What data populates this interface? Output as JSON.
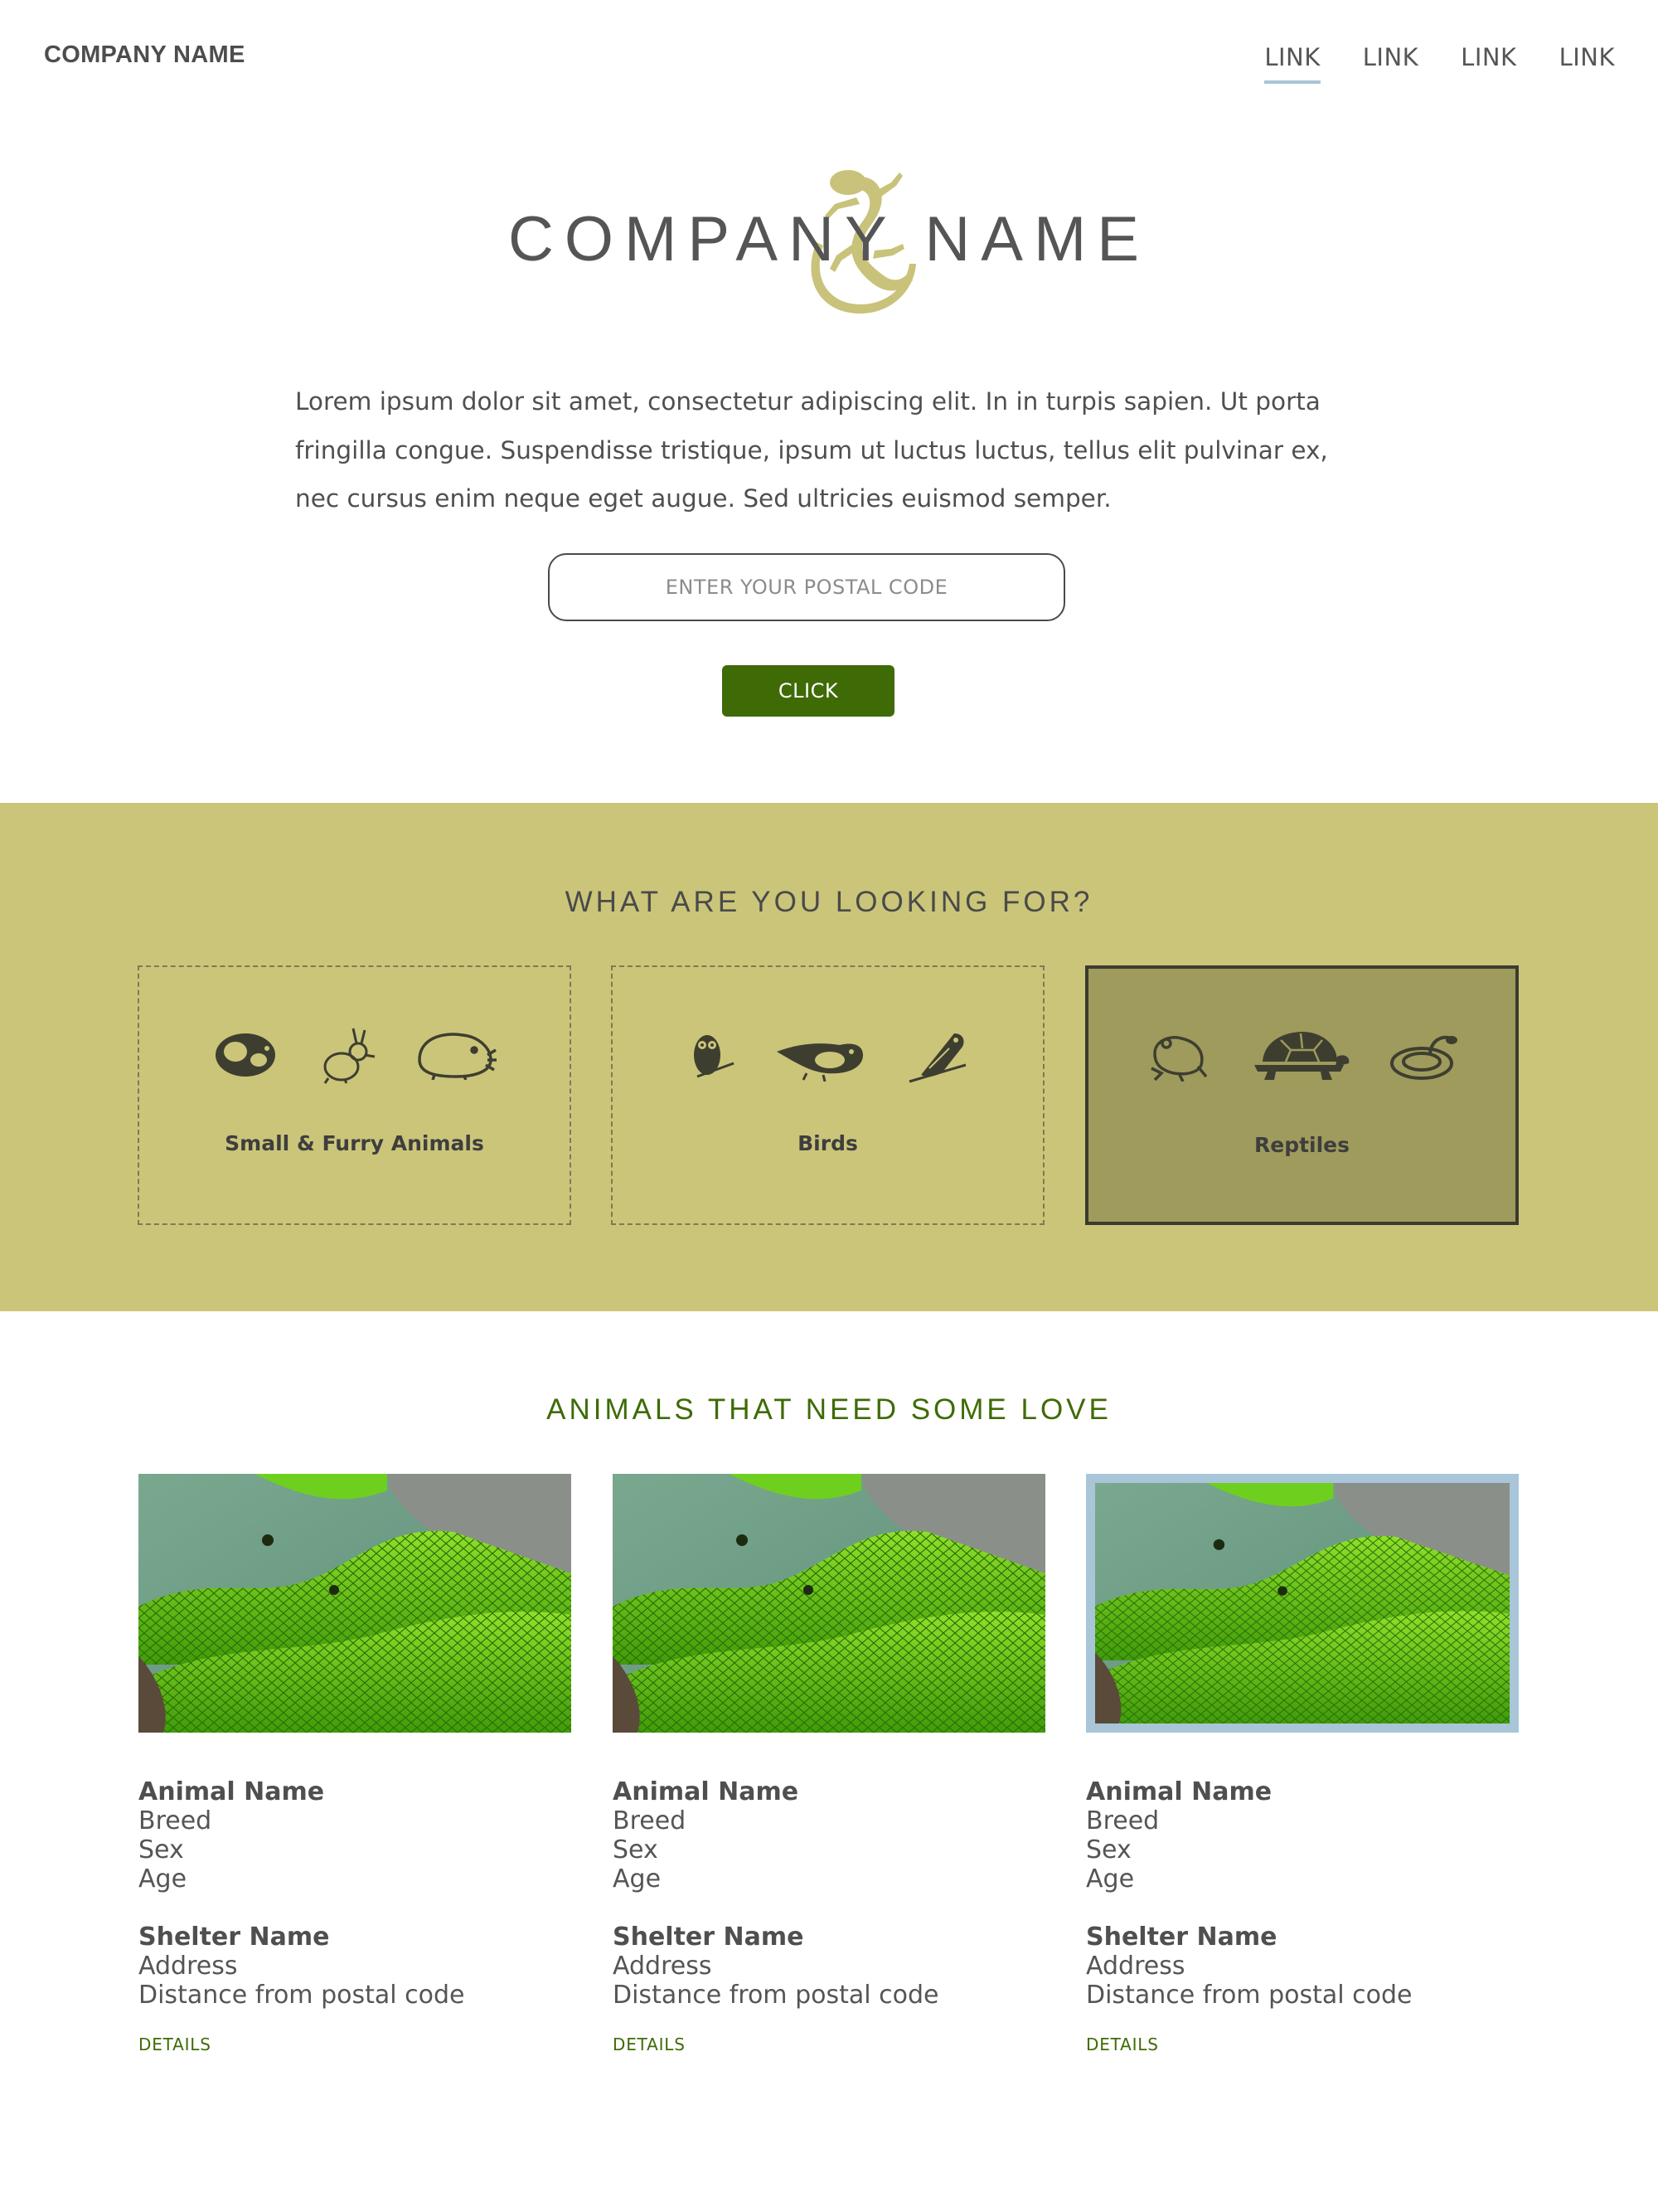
{
  "header": {
    "brand": "COMPANY NAME",
    "nav": [
      {
        "label": "LINK",
        "active": true
      },
      {
        "label": "LINK",
        "active": false
      },
      {
        "label": "LINK",
        "active": false
      },
      {
        "label": "LINK",
        "active": false
      }
    ]
  },
  "hero": {
    "logo_text": "COMPANY NAME",
    "intro": "Lorem ipsum dolor sit amet, consectetur adipiscing elit. In in turpis sapien. Ut porta fringilla congue. Suspendisse tristique, ipsum ut luctus luctus, tellus elit pulvinar ex, nec cursus enim neque eget augue. Sed ultricies euismod semper.",
    "postal_placeholder": "ENTER YOUR POSTAL CODE",
    "postal_value": "",
    "button_label": "CLICK"
  },
  "categories": {
    "title": "WHAT ARE YOU LOOKING FOR?",
    "items": [
      {
        "label": "Small & Furry Animals",
        "icons": [
          "guinea-pig-icon",
          "rabbit-icon",
          "hamster-icon"
        ],
        "selected": false
      },
      {
        "label": "Birds",
        "icons": [
          "owl-icon",
          "sparrow-icon",
          "parrot-icon"
        ],
        "selected": false
      },
      {
        "label": "Reptiles",
        "icons": [
          "frog-icon",
          "turtle-icon",
          "snake-icon"
        ],
        "selected": true
      }
    ]
  },
  "animals": {
    "title": "ANIMALS THAT NEED SOME LOVE",
    "cards": [
      {
        "animal_name": "Animal Name",
        "breed": "Breed",
        "sex": "Sex",
        "age": "Age",
        "shelter_name": "Shelter Name",
        "address": "Address",
        "distance": "Distance from postal code",
        "details": "DETAILS",
        "selected": false
      },
      {
        "animal_name": "Animal Name",
        "breed": "Breed",
        "sex": "Sex",
        "age": "Age",
        "shelter_name": "Shelter Name",
        "address": "Address",
        "distance": "Distance from postal code",
        "details": "DETAILS",
        "selected": false
      },
      {
        "animal_name": "Animal Name",
        "breed": "Breed",
        "sex": "Sex",
        "age": "Age",
        "shelter_name": "Shelter Name",
        "address": "Address",
        "distance": "Distance from postal code",
        "details": "DETAILS",
        "selected": true
      }
    ]
  },
  "colors": {
    "accent_green": "#3f6b06",
    "band_olive": "#cbc57a",
    "selected_olive": "#9e9b5c",
    "lizard": "#c9c27a",
    "nav_underline": "#a9c5d8",
    "text": "#555555"
  }
}
